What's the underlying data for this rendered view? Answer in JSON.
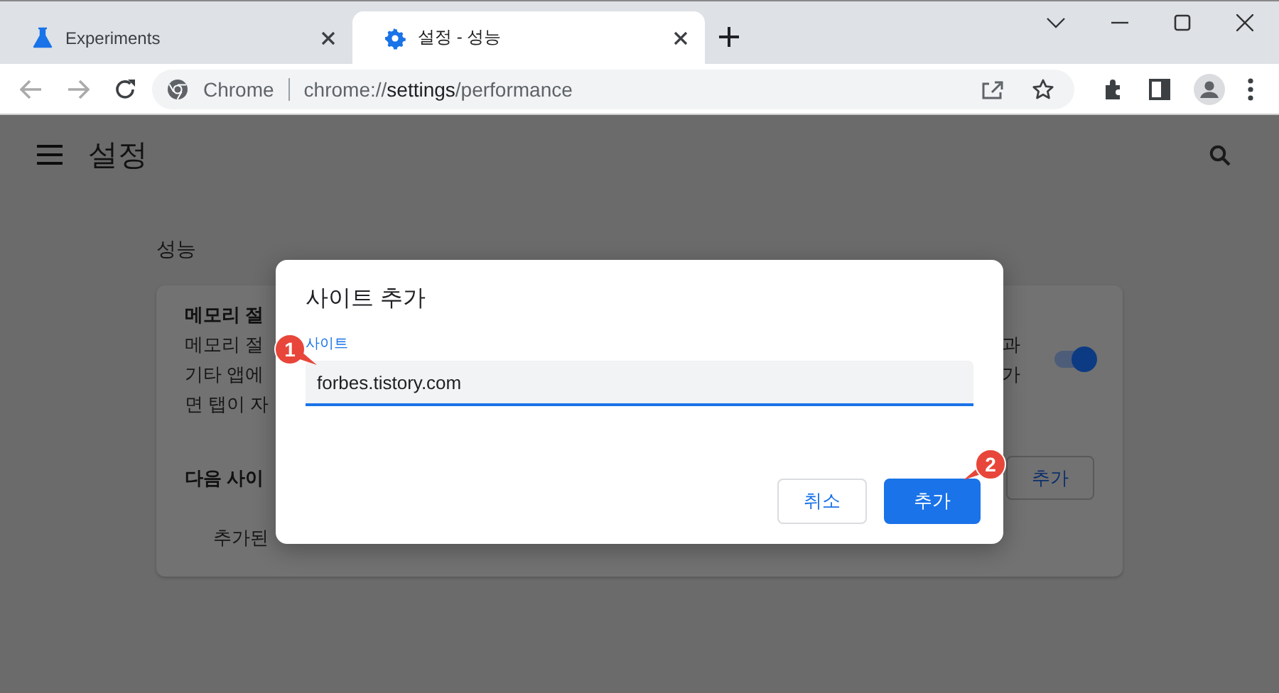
{
  "tabs": [
    {
      "label": "Experiments",
      "selected": false
    },
    {
      "label": "설정 - 성능",
      "selected": true
    }
  ],
  "toolbar": {
    "omnibox": {
      "site_label": "Chrome",
      "url": "chrome://**settings**/performance"
    }
  },
  "settings": {
    "title": "설정",
    "section_title": "성능",
    "card": {
      "lines": [
        "메모리 절",
        "메모리 절",
        "기타 앱에",
        "면 탭이 자"
      ],
      "right_lines": [
        "과",
        "가"
      ],
      "toggle": {
        "on": true
      },
      "site_row": {
        "label": "다음 사이",
        "button": "추가"
      },
      "added_label": "추가된"
    }
  },
  "dialog": {
    "title": "사이트 추가",
    "field": {
      "label": "사이트",
      "value": "forbes.tistory.com"
    },
    "buttons": [
      {
        "label": "취소",
        "kind": "secondary"
      },
      {
        "label": "추가",
        "kind": "primary"
      }
    ]
  },
  "annotations": [
    {
      "label": "1"
    },
    {
      "label": "2"
    }
  ]
}
